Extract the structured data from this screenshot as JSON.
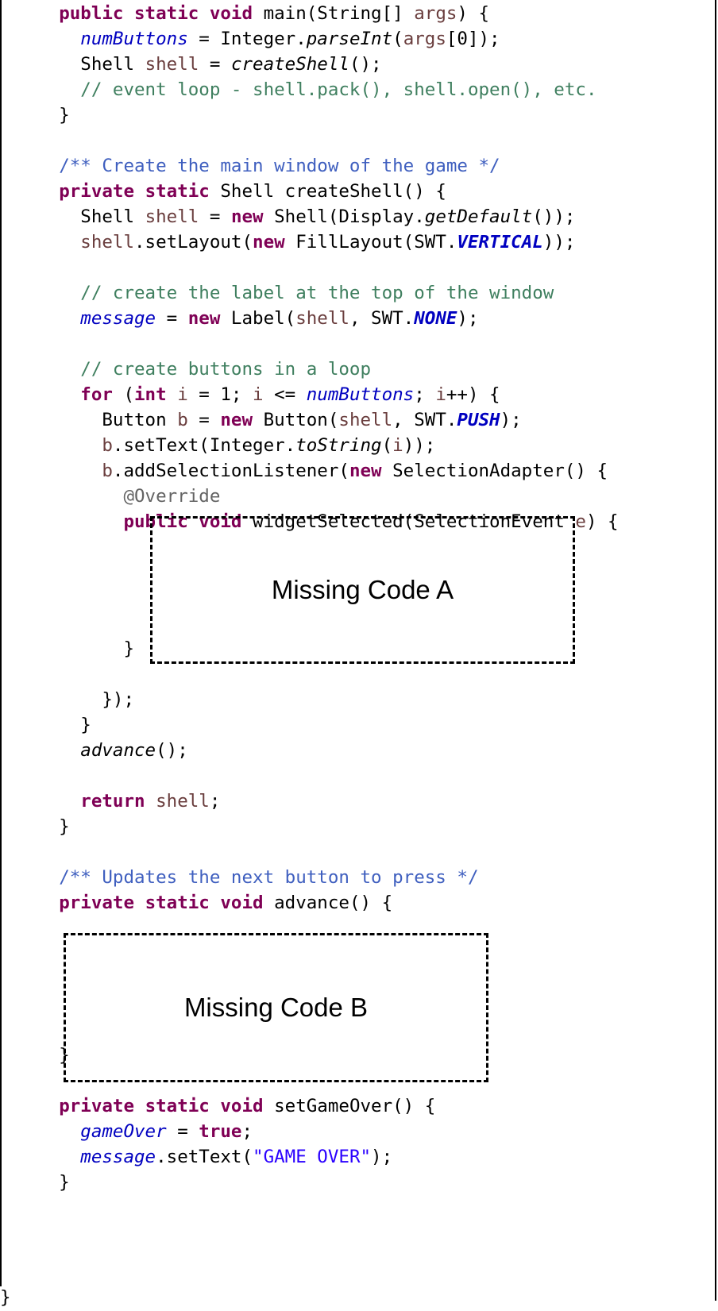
{
  "code_lines": [
    [
      "    ",
      [
        "kw",
        "public"
      ],
      " ",
      [
        "kw",
        "static"
      ],
      " ",
      [
        "kw",
        "void"
      ],
      " main(String[] ",
      [
        "var",
        "args"
      ],
      ") {"
    ],
    [
      "      ",
      [
        "fld",
        "numButtons"
      ],
      " = Integer.",
      [
        "sm",
        "parseInt"
      ],
      "(",
      [
        "var",
        "args"
      ],
      "[0]);"
    ],
    [
      "      Shell ",
      [
        "var",
        "shell"
      ],
      " = ",
      [
        "sm",
        "createShell"
      ],
      "();"
    ],
    [
      "      ",
      [
        "cm",
        "// event loop - shell.pack(), shell.open(), etc."
      ]
    ],
    [
      "    }"
    ],
    [
      ""
    ],
    [
      "    ",
      [
        "jd",
        "/** Create the main window of the game */"
      ]
    ],
    [
      "    ",
      [
        "kw",
        "private"
      ],
      " ",
      [
        "kw",
        "static"
      ],
      " Shell createShell() {"
    ],
    [
      "      Shell ",
      [
        "var",
        "shell"
      ],
      " = ",
      [
        "kw",
        "new"
      ],
      " Shell(Display.",
      [
        "sm",
        "getDefault"
      ],
      "());"
    ],
    [
      "      ",
      [
        "var",
        "shell"
      ],
      ".setLayout(",
      [
        "kw",
        "new"
      ],
      " FillLayout(SWT.",
      [
        "sfld",
        "VERTICAL"
      ],
      "));"
    ],
    [
      ""
    ],
    [
      "      ",
      [
        "cm",
        "// create the label at the top of the window"
      ]
    ],
    [
      "      ",
      [
        "fld",
        "message"
      ],
      " = ",
      [
        "kw",
        "new"
      ],
      " Label(",
      [
        "var",
        "shell"
      ],
      ", SWT.",
      [
        "sfld",
        "NONE"
      ],
      ");"
    ],
    [
      ""
    ],
    [
      "      ",
      [
        "cm",
        "// create buttons in a loop"
      ]
    ],
    [
      "      ",
      [
        "kw",
        "for"
      ],
      " (",
      [
        "kw",
        "int"
      ],
      " ",
      [
        "var",
        "i"
      ],
      " = 1; ",
      [
        "var",
        "i"
      ],
      " <= ",
      [
        "fld",
        "numButtons"
      ],
      "; ",
      [
        "var",
        "i"
      ],
      "++) {"
    ],
    [
      "        Button ",
      [
        "var",
        "b"
      ],
      " = ",
      [
        "kw",
        "new"
      ],
      " Button(",
      [
        "var",
        "shell"
      ],
      ", SWT.",
      [
        "sfld",
        "PUSH"
      ],
      ");"
    ],
    [
      "        ",
      [
        "var",
        "b"
      ],
      ".setText(Integer.",
      [
        "sm",
        "toString"
      ],
      "(",
      [
        "var",
        "i"
      ],
      "));"
    ],
    [
      "        ",
      [
        "var",
        "b"
      ],
      ".addSelectionListener(",
      [
        "kw",
        "new"
      ],
      " SelectionAdapter() {"
    ],
    [
      "          ",
      [
        "ann",
        "@Override"
      ]
    ],
    [
      "          ",
      [
        "kw",
        "public"
      ],
      " ",
      [
        "kw",
        "void"
      ],
      " widgetSelected(SelectionEvent ",
      [
        "var",
        "e"
      ],
      ") {"
    ],
    [
      ""
    ],
    [
      ""
    ],
    [
      ""
    ],
    [
      ""
    ],
    [
      "          }"
    ],
    [
      ""
    ],
    [
      "        });"
    ],
    [
      "      }"
    ],
    [
      "      ",
      [
        "sm",
        "advance"
      ],
      "();"
    ],
    [
      ""
    ],
    [
      "      ",
      [
        "kw",
        "return"
      ],
      " ",
      [
        "var",
        "shell"
      ],
      ";"
    ],
    [
      "    }"
    ],
    [
      ""
    ],
    [
      "    ",
      [
        "jd",
        "/** Updates the next button to press */"
      ]
    ],
    [
      "    ",
      [
        "kw",
        "private"
      ],
      " ",
      [
        "kw",
        "static"
      ],
      " ",
      [
        "kw",
        "void"
      ],
      " advance() {"
    ],
    [
      ""
    ],
    [
      ""
    ],
    [
      ""
    ],
    [
      ""
    ],
    [
      ""
    ],
    [
      "    }"
    ],
    [
      ""
    ],
    [
      "    ",
      [
        "kw",
        "private"
      ],
      " ",
      [
        "kw",
        "static"
      ],
      " ",
      [
        "kw",
        "void"
      ],
      " setGameOver() {"
    ],
    [
      "      ",
      [
        "fld",
        "gameOver"
      ],
      " = ",
      [
        "kw",
        "true"
      ],
      ";"
    ],
    [
      "      ",
      [
        "fld",
        "message"
      ],
      ".setText(",
      [
        "str",
        "\"GAME OVER\""
      ],
      ");"
    ],
    [
      "    }"
    ],
    [
      ""
    ]
  ],
  "missing_code_a": "Missing Code A",
  "missing_code_b": "Missing Code B",
  "closing_brace": "}"
}
